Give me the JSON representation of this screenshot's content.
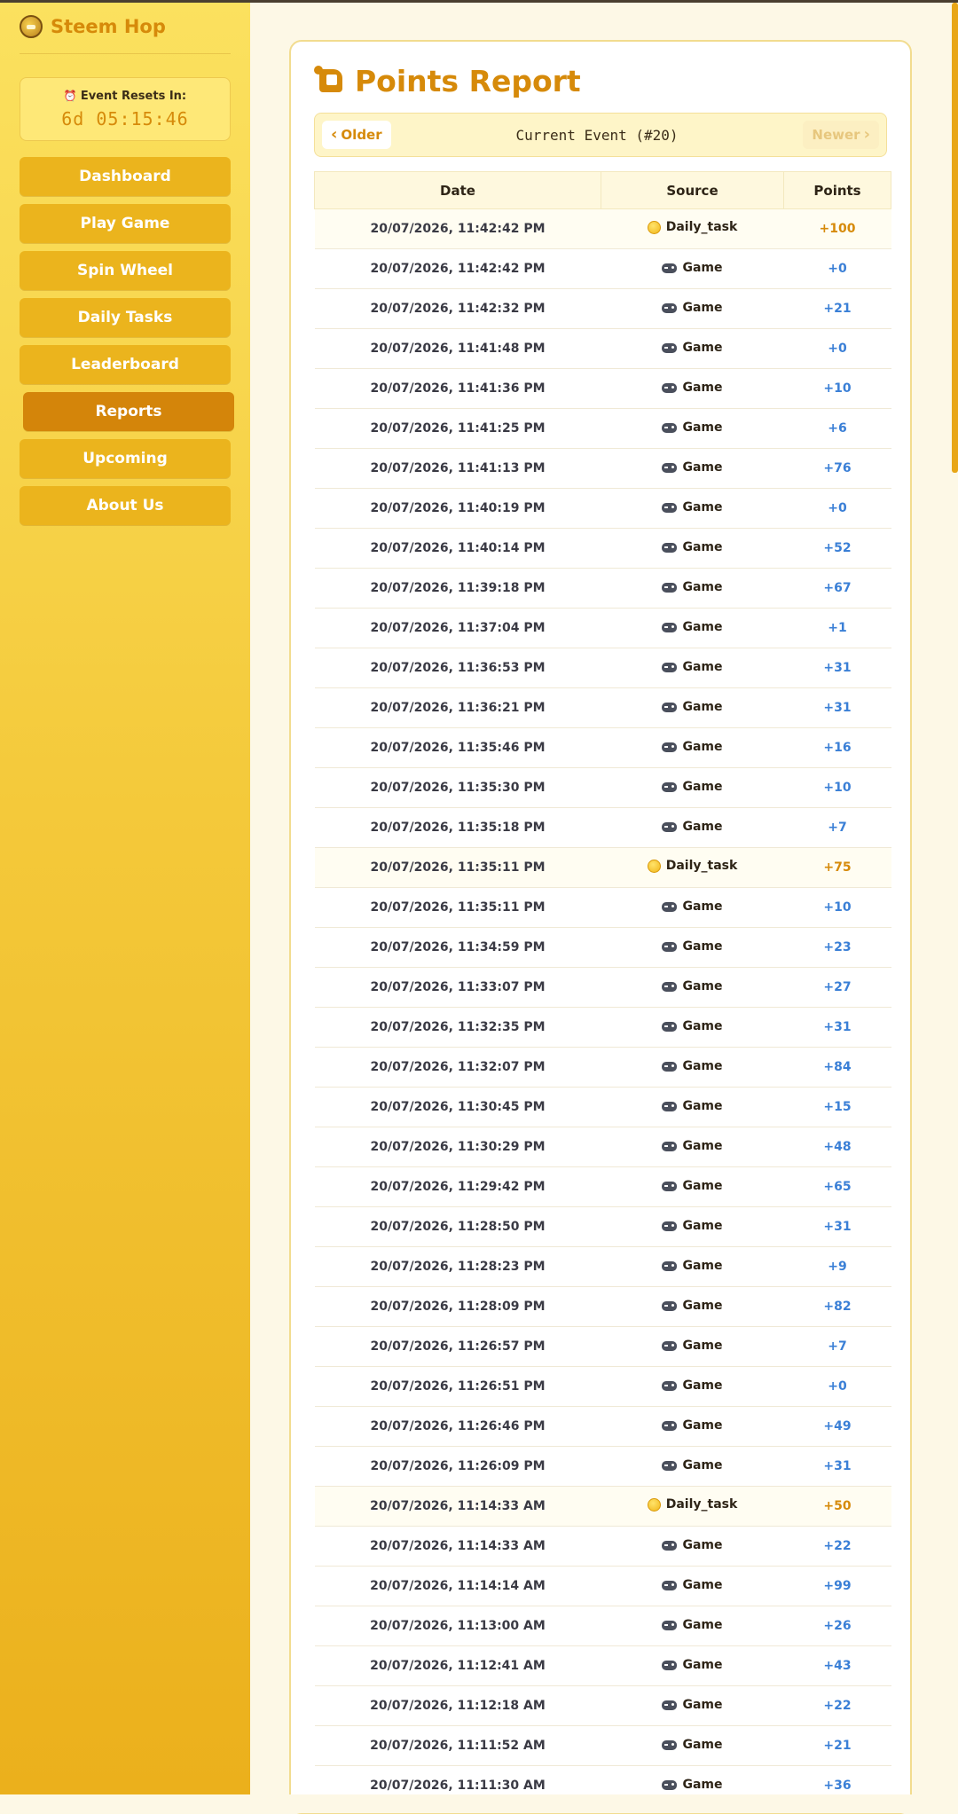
{
  "brand": {
    "name": "Steem Hop"
  },
  "timer": {
    "label": "Event Resets In:",
    "value": "6d 05:15:46"
  },
  "nav": [
    {
      "label": "Dashboard",
      "active": false
    },
    {
      "label": "Play Game",
      "active": false
    },
    {
      "label": "Spin Wheel",
      "active": false
    },
    {
      "label": "Daily Tasks",
      "active": false
    },
    {
      "label": "Leaderboard",
      "active": false
    },
    {
      "label": "Reports",
      "active": true
    },
    {
      "label": "Upcoming",
      "active": false
    },
    {
      "label": "About Us",
      "active": false
    }
  ],
  "page": {
    "title": "Points Report"
  },
  "pager": {
    "older_label": "Older",
    "current_label": "Current Event (#20)",
    "newer_label": "Newer"
  },
  "table": {
    "headers": [
      "Date",
      "Source",
      "Points"
    ],
    "rows": [
      {
        "date": "20/07/2026, 11:42:42 PM",
        "source": "Daily_task",
        "type": "daily",
        "points": "+100"
      },
      {
        "date": "20/07/2026, 11:42:42 PM",
        "source": "Game",
        "type": "game",
        "points": "+0"
      },
      {
        "date": "20/07/2026, 11:42:32 PM",
        "source": "Game",
        "type": "game",
        "points": "+21"
      },
      {
        "date": "20/07/2026, 11:41:48 PM",
        "source": "Game",
        "type": "game",
        "points": "+0"
      },
      {
        "date": "20/07/2026, 11:41:36 PM",
        "source": "Game",
        "type": "game",
        "points": "+10"
      },
      {
        "date": "20/07/2026, 11:41:25 PM",
        "source": "Game",
        "type": "game",
        "points": "+6"
      },
      {
        "date": "20/07/2026, 11:41:13 PM",
        "source": "Game",
        "type": "game",
        "points": "+76"
      },
      {
        "date": "20/07/2026, 11:40:19 PM",
        "source": "Game",
        "type": "game",
        "points": "+0"
      },
      {
        "date": "20/07/2026, 11:40:14 PM",
        "source": "Game",
        "type": "game",
        "points": "+52"
      },
      {
        "date": "20/07/2026, 11:39:18 PM",
        "source": "Game",
        "type": "game",
        "points": "+67"
      },
      {
        "date": "20/07/2026, 11:37:04 PM",
        "source": "Game",
        "type": "game",
        "points": "+1"
      },
      {
        "date": "20/07/2026, 11:36:53 PM",
        "source": "Game",
        "type": "game",
        "points": "+31"
      },
      {
        "date": "20/07/2026, 11:36:21 PM",
        "source": "Game",
        "type": "game",
        "points": "+31"
      },
      {
        "date": "20/07/2026, 11:35:46 PM",
        "source": "Game",
        "type": "game",
        "points": "+16"
      },
      {
        "date": "20/07/2026, 11:35:30 PM",
        "source": "Game",
        "type": "game",
        "points": "+10"
      },
      {
        "date": "20/07/2026, 11:35:18 PM",
        "source": "Game",
        "type": "game",
        "points": "+7"
      },
      {
        "date": "20/07/2026, 11:35:11 PM",
        "source": "Daily_task",
        "type": "daily",
        "points": "+75"
      },
      {
        "date": "20/07/2026, 11:35:11 PM",
        "source": "Game",
        "type": "game",
        "points": "+10"
      },
      {
        "date": "20/07/2026, 11:34:59 PM",
        "source": "Game",
        "type": "game",
        "points": "+23"
      },
      {
        "date": "20/07/2026, 11:33:07 PM",
        "source": "Game",
        "type": "game",
        "points": "+27"
      },
      {
        "date": "20/07/2026, 11:32:35 PM",
        "source": "Game",
        "type": "game",
        "points": "+31"
      },
      {
        "date": "20/07/2026, 11:32:07 PM",
        "source": "Game",
        "type": "game",
        "points": "+84"
      },
      {
        "date": "20/07/2026, 11:30:45 PM",
        "source": "Game",
        "type": "game",
        "points": "+15"
      },
      {
        "date": "20/07/2026, 11:30:29 PM",
        "source": "Game",
        "type": "game",
        "points": "+48"
      },
      {
        "date": "20/07/2026, 11:29:42 PM",
        "source": "Game",
        "type": "game",
        "points": "+65"
      },
      {
        "date": "20/07/2026, 11:28:50 PM",
        "source": "Game",
        "type": "game",
        "points": "+31"
      },
      {
        "date": "20/07/2026, 11:28:23 PM",
        "source": "Game",
        "type": "game",
        "points": "+9"
      },
      {
        "date": "20/07/2026, 11:28:09 PM",
        "source": "Game",
        "type": "game",
        "points": "+82"
      },
      {
        "date": "20/07/2026, 11:26:57 PM",
        "source": "Game",
        "type": "game",
        "points": "+7"
      },
      {
        "date": "20/07/2026, 11:26:51 PM",
        "source": "Game",
        "type": "game",
        "points": "+0"
      },
      {
        "date": "20/07/2026, 11:26:46 PM",
        "source": "Game",
        "type": "game",
        "points": "+49"
      },
      {
        "date": "20/07/2026, 11:26:09 PM",
        "source": "Game",
        "type": "game",
        "points": "+31"
      },
      {
        "date": "20/07/2026, 11:14:33 AM",
        "source": "Daily_task",
        "type": "daily",
        "points": "+50"
      },
      {
        "date": "20/07/2026, 11:14:33 AM",
        "source": "Game",
        "type": "game",
        "points": "+22"
      },
      {
        "date": "20/07/2026, 11:14:14 AM",
        "source": "Game",
        "type": "game",
        "points": "+99"
      },
      {
        "date": "20/07/2026, 11:13:00 AM",
        "source": "Game",
        "type": "game",
        "points": "+26"
      },
      {
        "date": "20/07/2026, 11:12:41 AM",
        "source": "Game",
        "type": "game",
        "points": "+43"
      },
      {
        "date": "20/07/2026, 11:12:18 AM",
        "source": "Game",
        "type": "game",
        "points": "+22"
      },
      {
        "date": "20/07/2026, 11:11:52 AM",
        "source": "Game",
        "type": "game",
        "points": "+21"
      },
      {
        "date": "20/07/2026, 11:11:30 AM",
        "source": "Game",
        "type": "game",
        "points": "+36"
      }
    ]
  },
  "icons": {
    "brand": "steem-hop-logo-icon",
    "timer": "alarm-clock-icon",
    "title": "scroll-icon",
    "daily": "coin-icon",
    "game": "gamepad-icon"
  },
  "colors": {
    "accent": "#d68a0a",
    "nav_button": "#ebb41d",
    "nav_active": "#d4850a",
    "points_game": "#3a7fd6",
    "points_daily": "#d68a0a"
  }
}
